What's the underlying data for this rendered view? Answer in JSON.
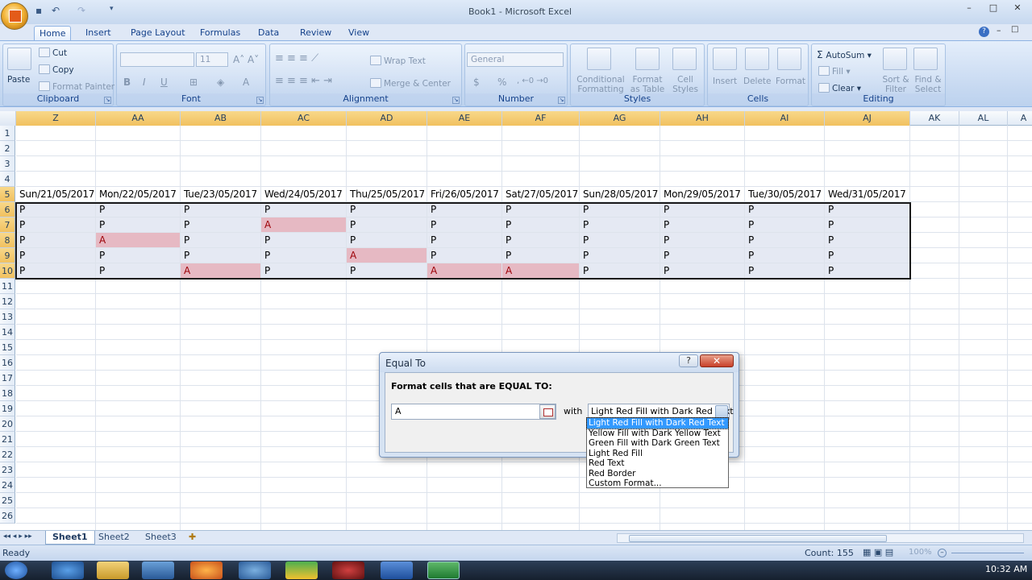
{
  "window": {
    "title": "Book1 - Microsoft Excel",
    "min": "–",
    "max": "□",
    "close": "✕"
  },
  "ribbon_tabs": [
    "Home",
    "Insert",
    "Page Layout",
    "Formulas",
    "Data",
    "Review",
    "View"
  ],
  "ribbon": {
    "clipboard": {
      "label": "Clipboard",
      "paste": "Paste",
      "cut": "Cut",
      "copy": "Copy",
      "format_painter": "Format Painter"
    },
    "font": {
      "label": "Font",
      "size": "11",
      "bold": "B",
      "italic": "I",
      "underline": "U"
    },
    "alignment": {
      "label": "Alignment",
      "wrap": "Wrap Text",
      "merge": "Merge & Center"
    },
    "number": {
      "label": "Number",
      "format": "General",
      "currency": "$",
      "percent": "%"
    },
    "styles": {
      "label": "Styles",
      "conditional": "Conditional Formatting",
      "format_table": "Format as Table",
      "cell_styles": "Cell Styles"
    },
    "cells": {
      "label": "Cells",
      "insert": "Insert",
      "delete": "Delete",
      "format": "Format"
    },
    "editing": {
      "label": "Editing",
      "autosum": "AutoSum",
      "fill": "Fill",
      "clear": "Clear",
      "sort": "Sort & Filter",
      "find": "Find & Select"
    }
  },
  "columns": [
    "Z",
    "AA",
    "AB",
    "AC",
    "AD",
    "AE",
    "AF",
    "AG",
    "AH",
    "AI",
    "AJ",
    "AK",
    "AL",
    "A"
  ],
  "rows": [
    "1",
    "2",
    "3",
    "4",
    "5",
    "6",
    "7",
    "8",
    "9",
    "10",
    "11",
    "12",
    "13",
    "14",
    "15",
    "16",
    "17",
    "18",
    "19",
    "20",
    "21",
    "22",
    "23",
    "24",
    "25",
    "26"
  ],
  "dates": [
    "Sun/21/05/2017",
    "Mon/22/05/2017",
    "Tue/23/05/2017",
    "Wed/24/05/2017",
    "Thu/25/05/2017",
    "Fri/26/05/2017",
    "Sat/27/05/2017",
    "Sun/28/05/2017",
    "Mon/29/05/2017",
    "Tue/30/05/2017",
    "Wed/31/05/2017"
  ],
  "attendance": [
    [
      "P",
      "P",
      "P",
      "P",
      "P",
      "P",
      "P",
      "P",
      "P",
      "P",
      "P"
    ],
    [
      "P",
      "P",
      "P",
      "A",
      "P",
      "P",
      "P",
      "P",
      "P",
      "P",
      "P"
    ],
    [
      "P",
      "A",
      "P",
      "P",
      "P",
      "P",
      "P",
      "P",
      "P",
      "P",
      "P"
    ],
    [
      "P",
      "P",
      "P",
      "P",
      "A",
      "P",
      "P",
      "P",
      "P",
      "P",
      "P"
    ],
    [
      "P",
      "P",
      "A",
      "P",
      "P",
      "A",
      "A",
      "P",
      "P",
      "P",
      "P"
    ]
  ],
  "sheets": [
    "Sheet1",
    "Sheet2",
    "Sheet3"
  ],
  "status": {
    "ready": "Ready",
    "count": "Count: 155",
    "zoom": "100%"
  },
  "clock": "10:32 AM",
  "dialog": {
    "title": "Equal To",
    "help": "?",
    "close": "✕",
    "prompt": "Format cells that are EQUAL TO:",
    "value": "A",
    "with_label": "with",
    "selected_format": "Light Red Fill with Dark Red Text",
    "options": [
      "Light Red Fill with Dark Red Text",
      "Yellow Fill with Dark Yellow Text",
      "Green Fill with Dark Green Text",
      "Light Red Fill",
      "Red Text",
      "Red Border",
      "Custom Format..."
    ]
  },
  "colors": {
    "highlight_fill": "#e6b9c3",
    "highlight_text": "#9c0006",
    "selection": "#e5e9f3"
  }
}
